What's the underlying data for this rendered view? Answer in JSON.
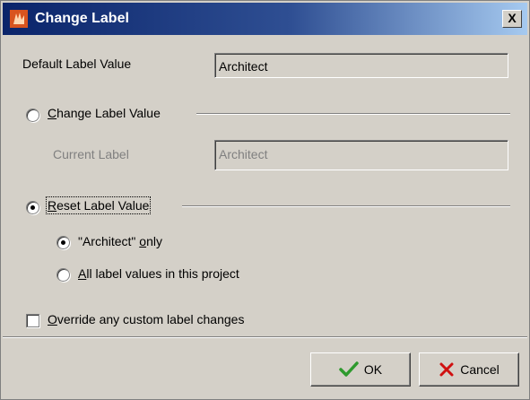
{
  "window": {
    "title": "Change Label",
    "close_glyph": "X"
  },
  "default_label": {
    "label": "Default Label Value",
    "value": "Architect"
  },
  "change_label": {
    "radio_label_prefix": "",
    "radio_label_mnemonic": "C",
    "radio_label_rest": "hange Label Value",
    "selected": false
  },
  "current_label": {
    "label": "Current Label",
    "value": "Architect"
  },
  "reset_label": {
    "radio_label_mnemonic": "R",
    "radio_label_rest": "eset Label Value",
    "selected": true
  },
  "reset_options": {
    "only": {
      "prefix": "\"Architect\" ",
      "mnemonic": "o",
      "rest": "nly",
      "selected": true
    },
    "all": {
      "mnemonic": "A",
      "rest": "ll label values in this project",
      "selected": false
    }
  },
  "override": {
    "mnemonic": "O",
    "rest": "verride any custom label changes",
    "checked": false
  },
  "buttons": {
    "ok": "OK",
    "cancel": "Cancel"
  },
  "colors": {
    "title_start": "#0a246a",
    "title_end": "#a6caf0",
    "face": "#d4d0c8",
    "ok_check": "#2e9a2e",
    "cancel_x": "#d01010"
  }
}
